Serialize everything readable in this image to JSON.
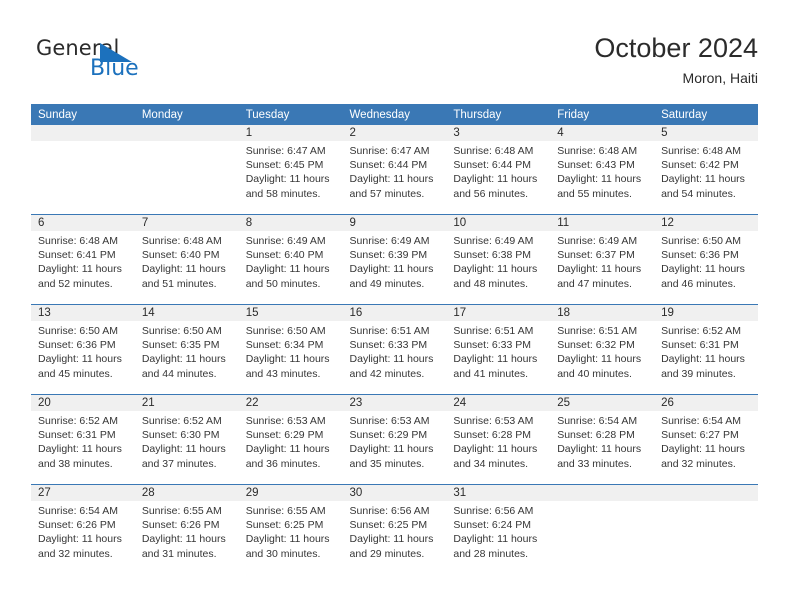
{
  "brand": {
    "name_top": "General",
    "name_bottom": "Blue",
    "color_primary": "#1c71bd",
    "color_text": "#2b2b2b",
    "triangle_icon": "triangle-icon"
  },
  "header": {
    "title": "October 2024",
    "subtitle": "Moron, Haiti"
  },
  "calendar": {
    "header_bg": "#3a78b5",
    "header_text": "#ffffff",
    "date_band_bg": "#f0f0f0",
    "weekdays": [
      "Sunday",
      "Monday",
      "Tuesday",
      "Wednesday",
      "Thursday",
      "Friday",
      "Saturday"
    ],
    "weeks": [
      [
        {
          "day": "",
          "lines": []
        },
        {
          "day": "",
          "lines": []
        },
        {
          "day": "1",
          "lines": [
            "Sunrise: 6:47 AM",
            "Sunset: 6:45 PM",
            "Daylight: 11 hours and 58 minutes."
          ]
        },
        {
          "day": "2",
          "lines": [
            "Sunrise: 6:47 AM",
            "Sunset: 6:44 PM",
            "Daylight: 11 hours and 57 minutes."
          ]
        },
        {
          "day": "3",
          "lines": [
            "Sunrise: 6:48 AM",
            "Sunset: 6:44 PM",
            "Daylight: 11 hours and 56 minutes."
          ]
        },
        {
          "day": "4",
          "lines": [
            "Sunrise: 6:48 AM",
            "Sunset: 6:43 PM",
            "Daylight: 11 hours and 55 minutes."
          ]
        },
        {
          "day": "5",
          "lines": [
            "Sunrise: 6:48 AM",
            "Sunset: 6:42 PM",
            "Daylight: 11 hours and 54 minutes."
          ]
        }
      ],
      [
        {
          "day": "6",
          "lines": [
            "Sunrise: 6:48 AM",
            "Sunset: 6:41 PM",
            "Daylight: 11 hours and 52 minutes."
          ]
        },
        {
          "day": "7",
          "lines": [
            "Sunrise: 6:48 AM",
            "Sunset: 6:40 PM",
            "Daylight: 11 hours and 51 minutes."
          ]
        },
        {
          "day": "8",
          "lines": [
            "Sunrise: 6:49 AM",
            "Sunset: 6:40 PM",
            "Daylight: 11 hours and 50 minutes."
          ]
        },
        {
          "day": "9",
          "lines": [
            "Sunrise: 6:49 AM",
            "Sunset: 6:39 PM",
            "Daylight: 11 hours and 49 minutes."
          ]
        },
        {
          "day": "10",
          "lines": [
            "Sunrise: 6:49 AM",
            "Sunset: 6:38 PM",
            "Daylight: 11 hours and 48 minutes."
          ]
        },
        {
          "day": "11",
          "lines": [
            "Sunrise: 6:49 AM",
            "Sunset: 6:37 PM",
            "Daylight: 11 hours and 47 minutes."
          ]
        },
        {
          "day": "12",
          "lines": [
            "Sunrise: 6:50 AM",
            "Sunset: 6:36 PM",
            "Daylight: 11 hours and 46 minutes."
          ]
        }
      ],
      [
        {
          "day": "13",
          "lines": [
            "Sunrise: 6:50 AM",
            "Sunset: 6:36 PM",
            "Daylight: 11 hours and 45 minutes."
          ]
        },
        {
          "day": "14",
          "lines": [
            "Sunrise: 6:50 AM",
            "Sunset: 6:35 PM",
            "Daylight: 11 hours and 44 minutes."
          ]
        },
        {
          "day": "15",
          "lines": [
            "Sunrise: 6:50 AM",
            "Sunset: 6:34 PM",
            "Daylight: 11 hours and 43 minutes."
          ]
        },
        {
          "day": "16",
          "lines": [
            "Sunrise: 6:51 AM",
            "Sunset: 6:33 PM",
            "Daylight: 11 hours and 42 minutes."
          ]
        },
        {
          "day": "17",
          "lines": [
            "Sunrise: 6:51 AM",
            "Sunset: 6:33 PM",
            "Daylight: 11 hours and 41 minutes."
          ]
        },
        {
          "day": "18",
          "lines": [
            "Sunrise: 6:51 AM",
            "Sunset: 6:32 PM",
            "Daylight: 11 hours and 40 minutes."
          ]
        },
        {
          "day": "19",
          "lines": [
            "Sunrise: 6:52 AM",
            "Sunset: 6:31 PM",
            "Daylight: 11 hours and 39 minutes."
          ]
        }
      ],
      [
        {
          "day": "20",
          "lines": [
            "Sunrise: 6:52 AM",
            "Sunset: 6:31 PM",
            "Daylight: 11 hours and 38 minutes."
          ]
        },
        {
          "day": "21",
          "lines": [
            "Sunrise: 6:52 AM",
            "Sunset: 6:30 PM",
            "Daylight: 11 hours and 37 minutes."
          ]
        },
        {
          "day": "22",
          "lines": [
            "Sunrise: 6:53 AM",
            "Sunset: 6:29 PM",
            "Daylight: 11 hours and 36 minutes."
          ]
        },
        {
          "day": "23",
          "lines": [
            "Sunrise: 6:53 AM",
            "Sunset: 6:29 PM",
            "Daylight: 11 hours and 35 minutes."
          ]
        },
        {
          "day": "24",
          "lines": [
            "Sunrise: 6:53 AM",
            "Sunset: 6:28 PM",
            "Daylight: 11 hours and 34 minutes."
          ]
        },
        {
          "day": "25",
          "lines": [
            "Sunrise: 6:54 AM",
            "Sunset: 6:28 PM",
            "Daylight: 11 hours and 33 minutes."
          ]
        },
        {
          "day": "26",
          "lines": [
            "Sunrise: 6:54 AM",
            "Sunset: 6:27 PM",
            "Daylight: 11 hours and 32 minutes."
          ]
        }
      ],
      [
        {
          "day": "27",
          "lines": [
            "Sunrise: 6:54 AM",
            "Sunset: 6:26 PM",
            "Daylight: 11 hours and 32 minutes."
          ]
        },
        {
          "day": "28",
          "lines": [
            "Sunrise: 6:55 AM",
            "Sunset: 6:26 PM",
            "Daylight: 11 hours and 31 minutes."
          ]
        },
        {
          "day": "29",
          "lines": [
            "Sunrise: 6:55 AM",
            "Sunset: 6:25 PM",
            "Daylight: 11 hours and 30 minutes."
          ]
        },
        {
          "day": "30",
          "lines": [
            "Sunrise: 6:56 AM",
            "Sunset: 6:25 PM",
            "Daylight: 11 hours and 29 minutes."
          ]
        },
        {
          "day": "31",
          "lines": [
            "Sunrise: 6:56 AM",
            "Sunset: 6:24 PM",
            "Daylight: 11 hours and 28 minutes."
          ]
        },
        {
          "day": "",
          "lines": []
        },
        {
          "day": "",
          "lines": []
        }
      ]
    ]
  }
}
